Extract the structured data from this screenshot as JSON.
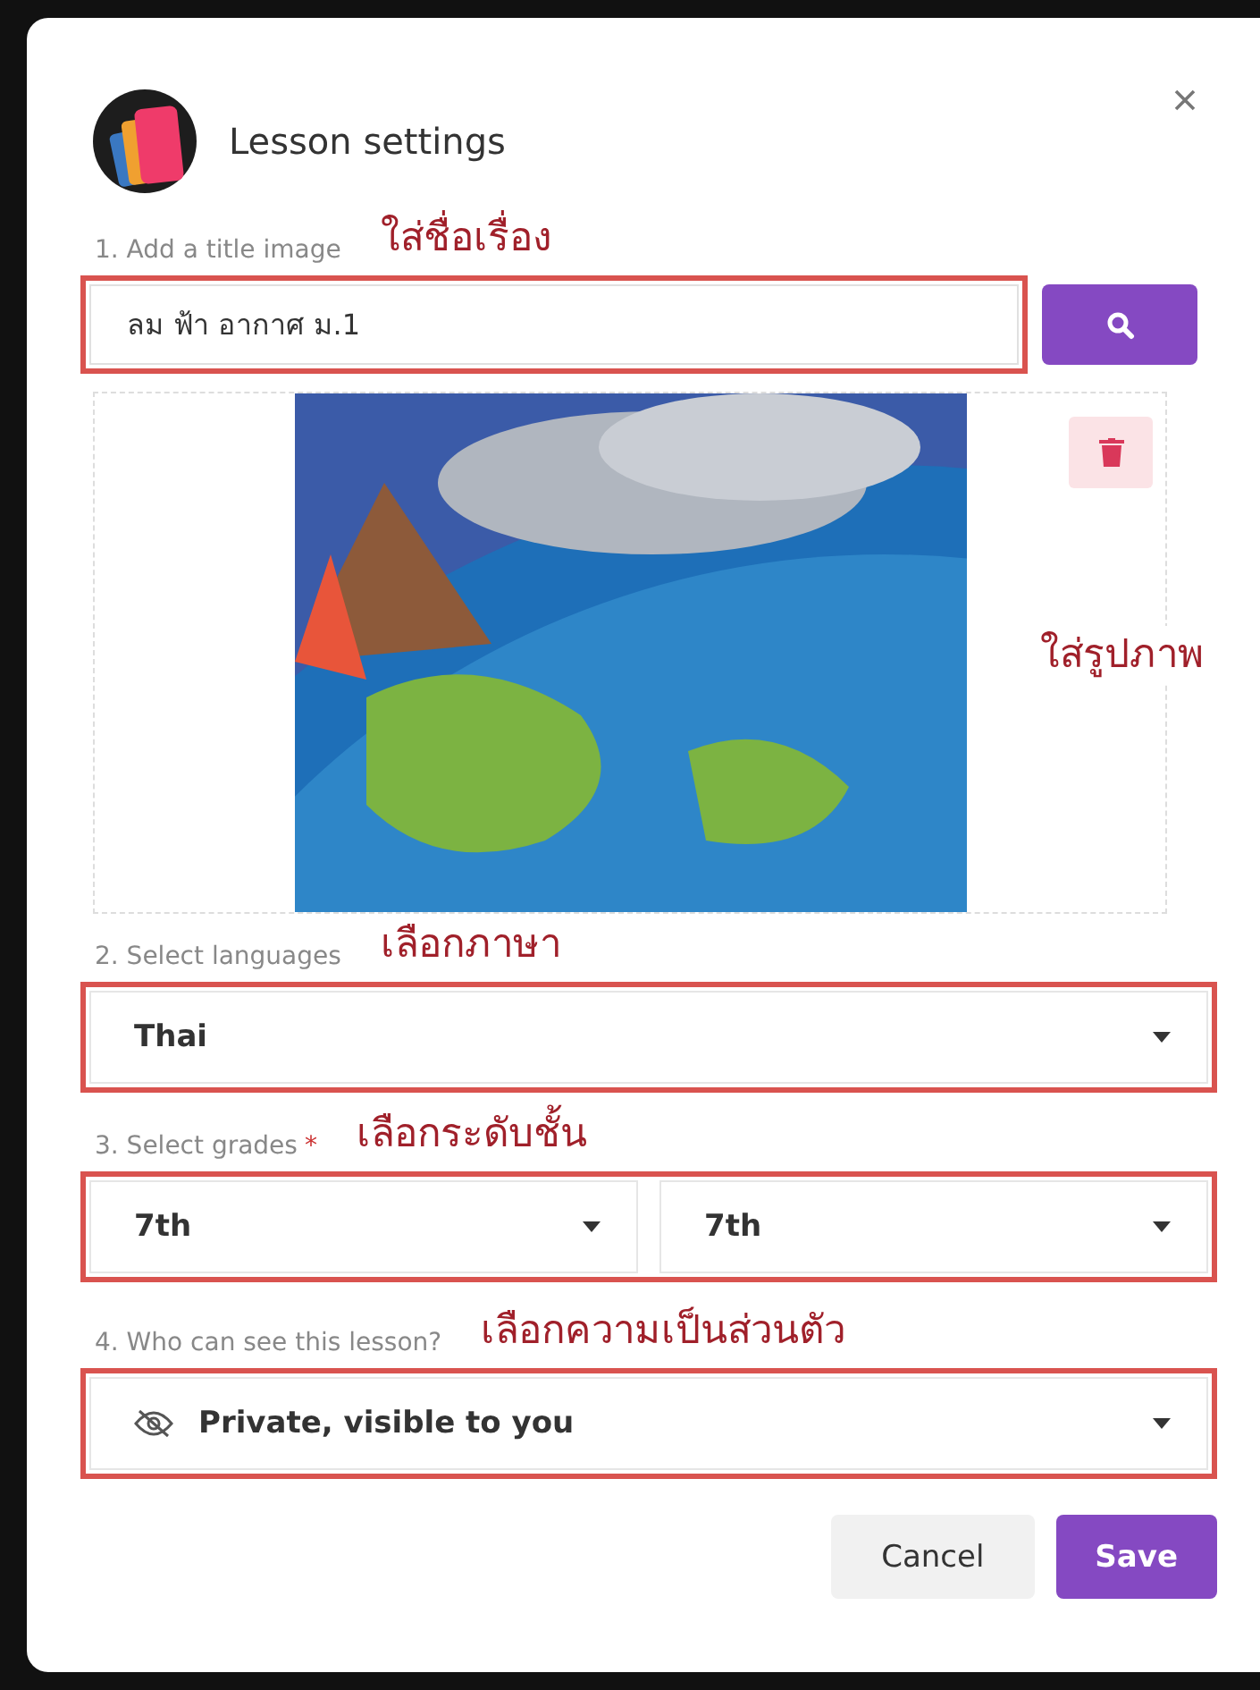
{
  "dialog": {
    "title": "Lesson settings"
  },
  "title_image": {
    "label": "1. Add a title image",
    "note": "ใส่ชื่อเรื่อง",
    "value": "ลม ฟ้า อากาศ ม.1",
    "image_note": "ใส่รูปภาพ"
  },
  "language": {
    "label": "2. Select languages",
    "note": "เลือกภาษา",
    "value": "Thai"
  },
  "grades": {
    "label": "3. Select grades",
    "required_mark": "*",
    "note": "เลือกระดับชั้น",
    "from": "7th",
    "to": "7th"
  },
  "visibility": {
    "label": "4. Who can see this lesson?",
    "note": "เลือกความเป็นส่วนตัว",
    "value": "Private, visible to you"
  },
  "buttons": [
    {
      "label": "Cancel",
      "kind": "secondary"
    },
    {
      "label": "Save",
      "kind": "primary"
    }
  ]
}
